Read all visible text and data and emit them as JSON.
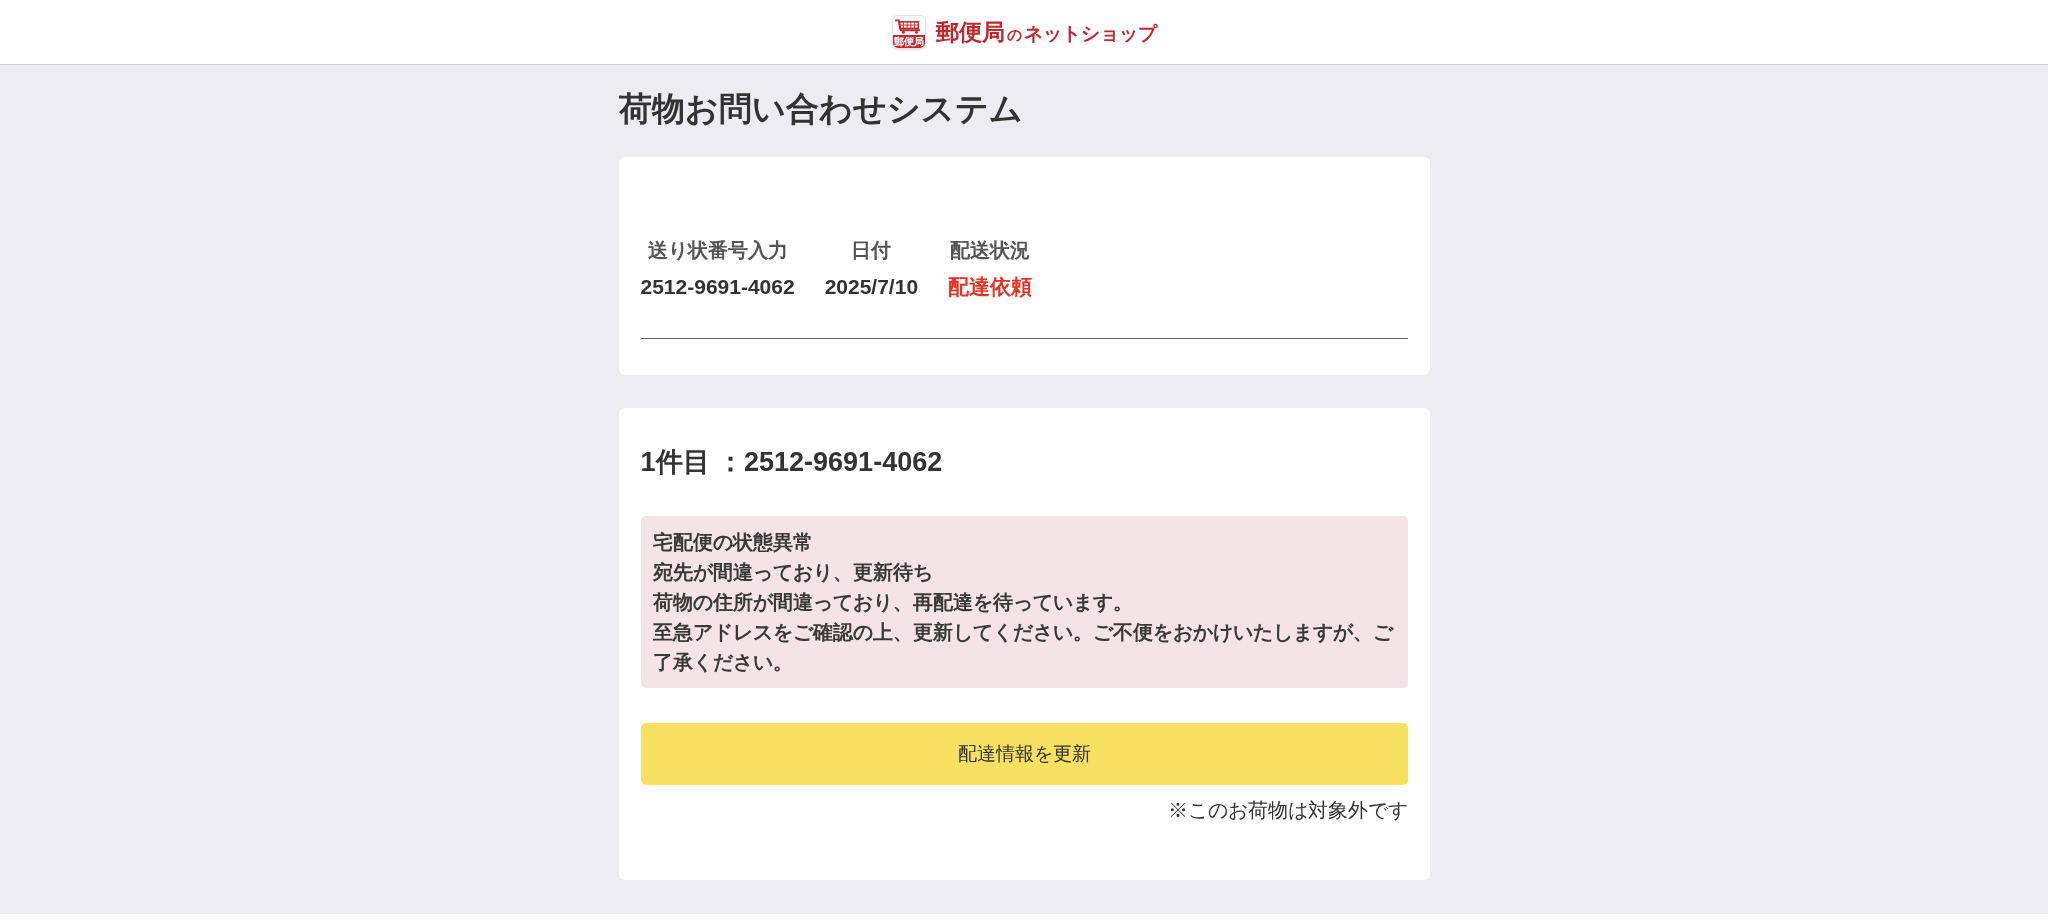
{
  "header": {
    "logo": {
      "badge": "郵便局",
      "text_parts": [
        "郵便局",
        "の",
        "ネットショップ"
      ]
    }
  },
  "page_title": "荷物お問い合わせシステム",
  "summary": {
    "columns": [
      "送り状番号入力",
      "日付",
      "配送状況"
    ],
    "rows": [
      {
        "tracking_number": "2512-9691-4062",
        "date": "2025/7/10",
        "status": "配達依頼",
        "urgent": true
      }
    ]
  },
  "detail": {
    "heading": "1件目 ：2512-9691-4062",
    "alert": {
      "lines": [
        "宅配便の状態異常",
        "宛先が間違っており、更新待ち",
        "荷物の住所が間違っており、再配達を待っています。",
        "至急アドレスをご確認の上、更新してください。ご不便をおかけいたしますが、ご了承ください。"
      ]
    },
    "button": "配達情報を更新",
    "note": "※このお荷物は対象外です"
  }
}
